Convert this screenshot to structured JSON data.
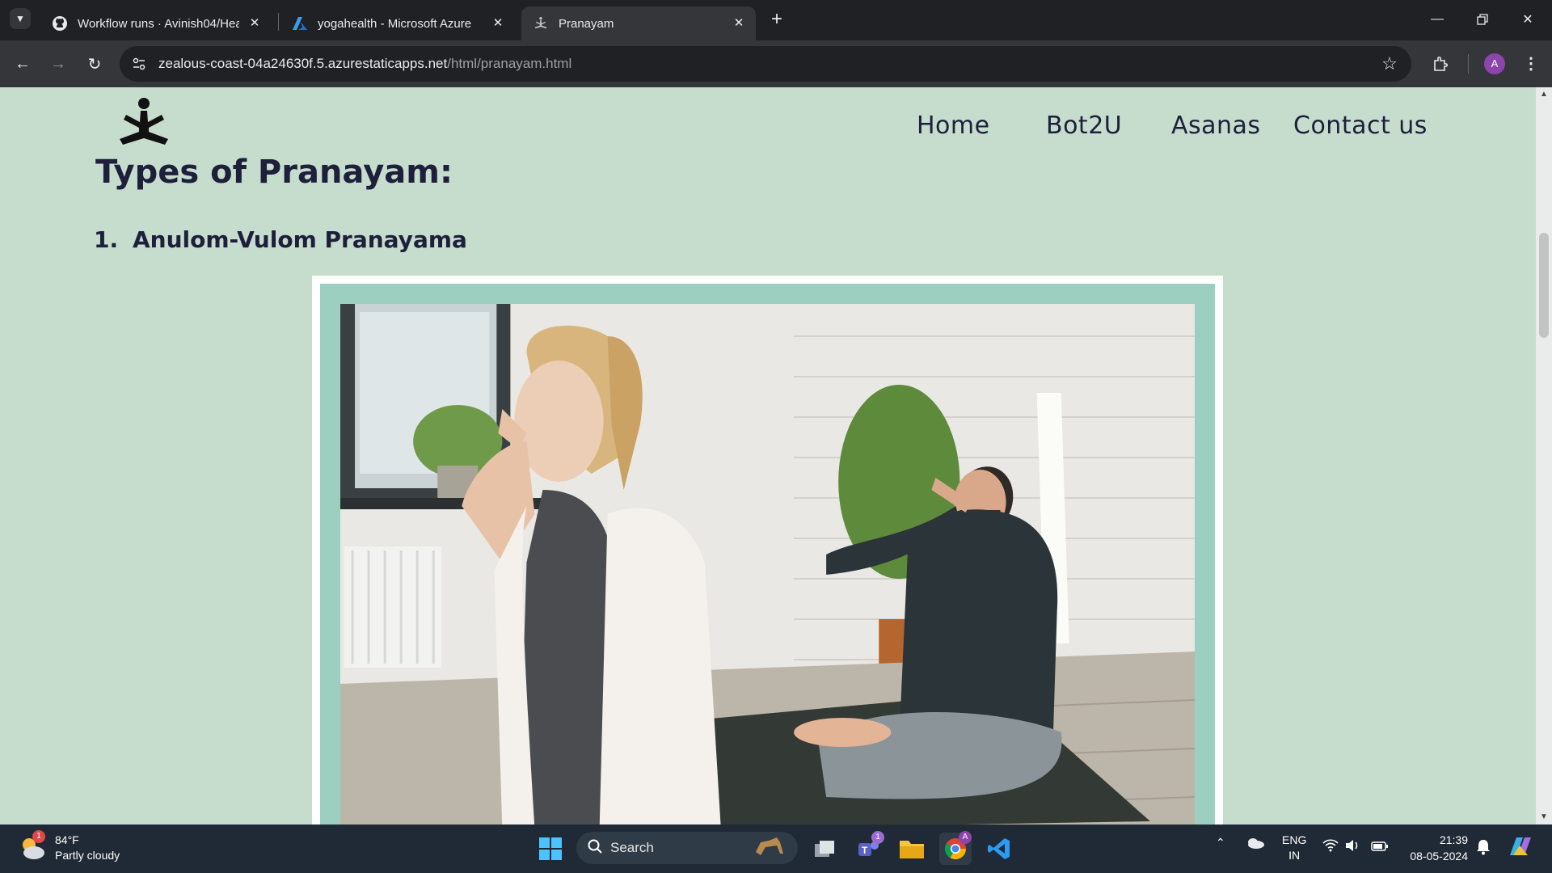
{
  "browser": {
    "tabs": [
      {
        "title": "Workflow runs · Avinish04/Heal",
        "icon": "github-icon",
        "active": false
      },
      {
        "title": "yogahealth - Microsoft Azure",
        "icon": "azure-icon",
        "active": false
      },
      {
        "title": "Pranayam",
        "icon": "yoga-pose-icon",
        "active": true
      }
    ],
    "url_host": "zealous-coast-04a24630f.5.azurestaticapps.net",
    "url_path": "/html/pranayam.html",
    "profile_initial": "A"
  },
  "page": {
    "nav": {
      "home": "Home",
      "bot": "Bot2U",
      "asanas": "Asanas",
      "contact": "Contact us"
    },
    "heading": "Types of Pranayam:",
    "items": [
      {
        "number": "1.",
        "title": "Anulom-Vulom Pranayama"
      }
    ],
    "colors": {
      "background": "#c6ddcd",
      "text": "#1d1f3b",
      "photo_mat": "#9ccfbf"
    }
  },
  "taskbar": {
    "weather_temp": "84°F",
    "weather_desc": "Partly cloudy",
    "weather_badge": "1",
    "search_label": "Search",
    "teams_badge": "1",
    "lang_top": "ENG",
    "lang_bottom": "IN",
    "time": "21:39",
    "date": "08-05-2024"
  }
}
